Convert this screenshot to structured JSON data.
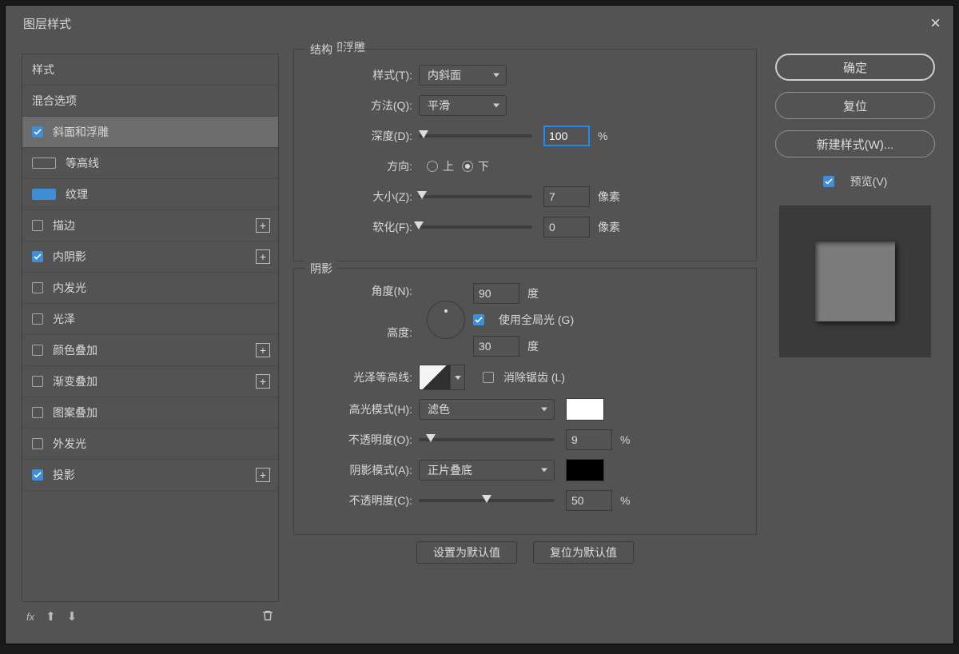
{
  "title": "图层样式",
  "close_icon": "×",
  "sidebar": {
    "headers": {
      "styles": "样式",
      "blend": "混合选项"
    },
    "items": [
      {
        "label": "斜面和浮雕",
        "checked": true,
        "selected": true,
        "plus": false,
        "indent": false
      },
      {
        "label": "等高线",
        "checked": false,
        "selected": false,
        "plus": false,
        "indent": true
      },
      {
        "label": "纹理",
        "checked": true,
        "selected": false,
        "plus": false,
        "indent": true
      },
      {
        "label": "描边",
        "checked": false,
        "selected": false,
        "plus": true,
        "indent": false
      },
      {
        "label": "内阴影",
        "checked": true,
        "selected": false,
        "plus": true,
        "indent": false
      },
      {
        "label": "内发光",
        "checked": false,
        "selected": false,
        "plus": false,
        "indent": false
      },
      {
        "label": "光泽",
        "checked": false,
        "selected": false,
        "plus": false,
        "indent": false
      },
      {
        "label": "颜色叠加",
        "checked": false,
        "selected": false,
        "plus": true,
        "indent": false
      },
      {
        "label": "渐变叠加",
        "checked": false,
        "selected": false,
        "plus": true,
        "indent": false
      },
      {
        "label": "图案叠加",
        "checked": false,
        "selected": false,
        "plus": false,
        "indent": false
      },
      {
        "label": "外发光",
        "checked": false,
        "selected": false,
        "plus": false,
        "indent": false
      },
      {
        "label": "投影",
        "checked": true,
        "selected": false,
        "plus": true,
        "indent": false
      }
    ],
    "bottom": {
      "fx": "fx"
    }
  },
  "content": {
    "outer_label": "斜面和浮雕",
    "structure": {
      "label": "结构",
      "style_lbl": "样式(T):",
      "style_val": "内斜面",
      "method_lbl": "方法(Q):",
      "method_val": "平滑",
      "depth_lbl": "深度(D):",
      "depth_val": "100",
      "depth_unit": "%",
      "dir_lbl": "方向:",
      "dir_up": "上",
      "dir_down": "下",
      "size_lbl": "大小(Z):",
      "size_val": "7",
      "size_unit": "像素",
      "soften_lbl": "软化(F):",
      "soften_val": "0",
      "soften_unit": "像素"
    },
    "shading": {
      "label": "阴影",
      "angle_lbl": "角度(N):",
      "angle_val": "90",
      "angle_unit": "度",
      "global_light": "使用全局光 (G)",
      "altitude_lbl": "高度:",
      "altitude_val": "30",
      "altitude_unit": "度",
      "gloss_lbl": "光泽等高线:",
      "antialias": "消除锯齿 (L)",
      "hl_mode_lbl": "高光模式(H):",
      "hl_mode_val": "滤色",
      "hl_opacity_lbl": "不透明度(O):",
      "hl_opacity_val": "9",
      "pct": "%",
      "sh_mode_lbl": "阴影模式(A):",
      "sh_mode_val": "正片叠底",
      "sh_opacity_lbl": "不透明度(C):",
      "sh_opacity_val": "50"
    },
    "buttons": {
      "set_default": "设置为默认值",
      "reset_default": "复位为默认值"
    }
  },
  "right": {
    "ok": "确定",
    "cancel": "复位",
    "new_style": "新建样式(W)...",
    "preview_lbl": "预览(V)"
  }
}
